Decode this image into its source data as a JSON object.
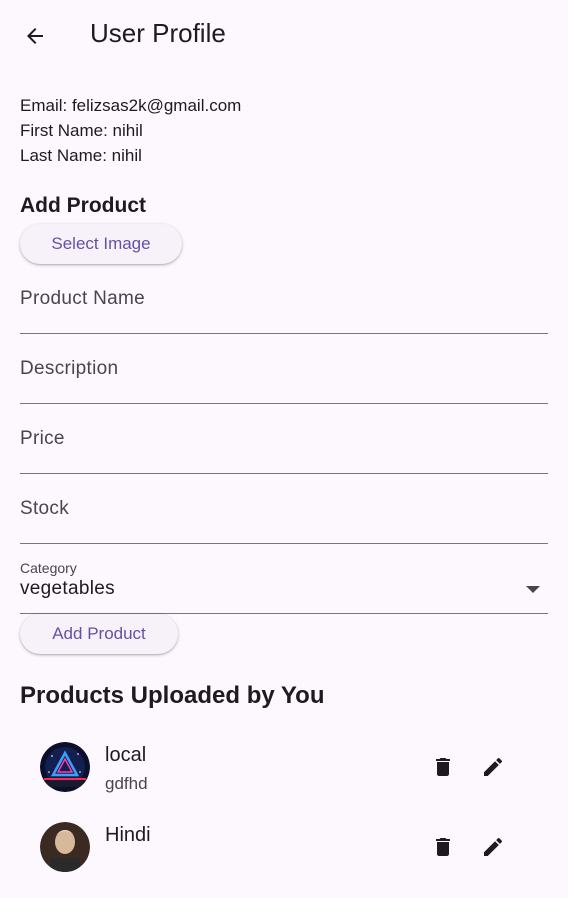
{
  "app_bar": {
    "title": "User Profile",
    "back_icon": "arrow-back-icon"
  },
  "user_info": {
    "email_line": "Email: felizsas2k@gmail.com",
    "first_name_line": "First Name: nihil",
    "last_name_line": "Last Name: nihil"
  },
  "add_product": {
    "title": "Add Product",
    "select_image_label": "Select Image",
    "fields": [
      {
        "label": "Product Name",
        "value": ""
      },
      {
        "label": "Description",
        "value": ""
      },
      {
        "label": "Price",
        "value": ""
      },
      {
        "label": "Stock",
        "value": ""
      }
    ],
    "category": {
      "label": "Category",
      "value": "vegetables",
      "icon": "arrow-drop-down-icon"
    },
    "submit_label": "Add Product"
  },
  "uploaded": {
    "title": "Products Uploaded by You",
    "items": [
      {
        "title": "local",
        "subtitle": "gdfhd",
        "delete_icon": "trash-icon",
        "edit_icon": "pencil-icon"
      },
      {
        "title": "Hindi",
        "subtitle": "",
        "delete_icon": "trash-icon",
        "edit_icon": "pencil-icon"
      }
    ]
  },
  "colors": {
    "background": "#fdf7fe",
    "primary": "#6750a4",
    "text": "#1d1b20",
    "secondary_text": "#49454f",
    "divider": "#79747e"
  }
}
